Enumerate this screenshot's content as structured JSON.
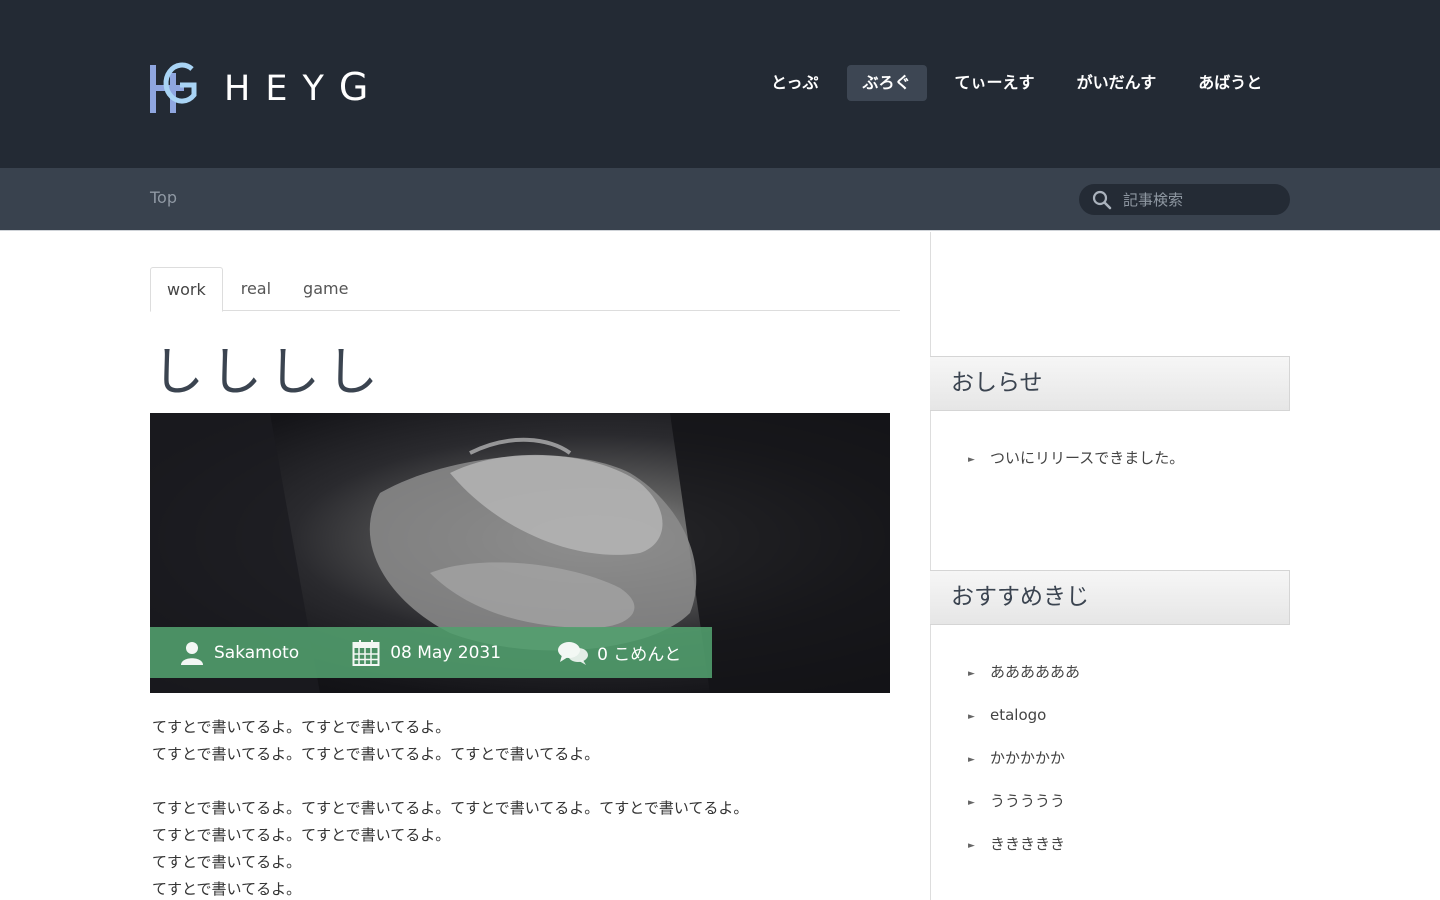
{
  "brand": {
    "logo_text_first": "H",
    "logo_text_rest": "EY",
    "logo_text_last": "G"
  },
  "nav": {
    "items": [
      {
        "label": "とっぷ"
      },
      {
        "label": "ぶろぐ",
        "active": true
      },
      {
        "label": "てぃーえす"
      },
      {
        "label": "がいだんす"
      },
      {
        "label": "あばうと"
      }
    ]
  },
  "breadcrumb": {
    "label": "Top"
  },
  "search": {
    "placeholder": "記事検索"
  },
  "tabs": [
    {
      "label": "work",
      "active": true
    },
    {
      "label": "real"
    },
    {
      "label": "game"
    }
  ],
  "post": {
    "title": "しししし",
    "author": "Sakamoto",
    "date": "08 May 2031",
    "comments": "0 こめんと",
    "paragraphs": [
      [
        "てすとで書いてるよ。てすとで書いてるよ。",
        "てすとで書いてるよ。てすとで書いてるよ。てすとで書いてるよ。"
      ],
      [
        "てすとで書いてるよ。てすとで書いてるよ。てすとで書いてるよ。てすとで書いてるよ。",
        "てすとで書いてるよ。てすとで書いてるよ。",
        "てすとで書いてるよ。",
        "てすとで書いてるよ。"
      ]
    ]
  },
  "sidebar": {
    "news": {
      "title": "おしらせ",
      "items": [
        "ついにリリースできました。"
      ]
    },
    "recommended": {
      "title": "おすすめきじ",
      "items": [
        "ああああああ",
        "etalogo",
        "かかかかか",
        "ううううう",
        "ききききき"
      ]
    }
  },
  "colors": {
    "header_bg": "#232a34",
    "subbar_bg": "#39424e",
    "meta_bar": "#52a06e",
    "logo_accent": "#8fb0e8"
  }
}
